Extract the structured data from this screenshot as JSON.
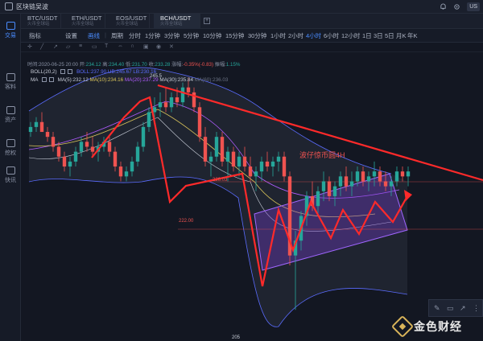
{
  "app": {
    "title": "区块链吴波"
  },
  "topbar": {
    "user_label": "US"
  },
  "sidebar": {
    "items": [
      {
        "label": "交易",
        "active": true
      },
      {
        "label": "客料",
        "active": false
      },
      {
        "label": "资产",
        "active": false
      },
      {
        "label": "挖权",
        "active": false
      },
      {
        "label": "快讯",
        "active": false
      }
    ]
  },
  "tabs": [
    {
      "symbol": "BTC/USDT",
      "sub": "火币全球站"
    },
    {
      "symbol": "ETH/USDT",
      "sub": "火币全球站"
    },
    {
      "symbol": "EOS/USDT",
      "sub": "火币全球站"
    },
    {
      "symbol": "BCH/USDT",
      "sub": "火币全球站",
      "active": true
    }
  ],
  "toolbar": {
    "left": [
      "指标",
      "设置",
      "画线"
    ],
    "period_label": "周期",
    "periods": [
      "分时",
      "1分钟",
      "3分钟",
      "5分钟",
      "10分钟",
      "15分钟",
      "30分钟",
      "1小时",
      "2小时",
      "4小时",
      "6小时",
      "12小时",
      "1日",
      "3日",
      "5日",
      "月K",
      "年K"
    ],
    "active_period": "4小时"
  },
  "ohlc": {
    "time_label": "时间:",
    "time": "2020-06-25 20:00",
    "open_label": "开:",
    "open": "234.12",
    "high_label": "高:",
    "high": "234.40",
    "low_label": "低:",
    "low": "231.70",
    "close_label": "收:",
    "close": "233.28",
    "change_label": "涨幅:",
    "change": "-0.35%(-0.83)",
    "amp_label": "振幅:",
    "amp": "1.15%"
  },
  "indicators": {
    "boll": {
      "name": "BOLL(20,2)",
      "text": "BOLL:237.90 UB:245.67 LB:230.16"
    },
    "ma": {
      "name": "MA",
      "ma5": "MA(5):232.12",
      "ma10": "MA(10):234.16",
      "ma20": "MA(20):237.29",
      "ma30": "MA(30):235.84",
      "ma60": "MA(60):236.03"
    }
  },
  "chart_labels": {
    "high_marker": "245.5",
    "level_1": "226.03",
    "level_2": "222.00",
    "low_marker": "205",
    "annotation": "波仔惊币圆4H"
  },
  "colors": {
    "up": "#26a69a",
    "down": "#ef5350",
    "accent": "#4a8cff",
    "channel": "#7b3fd6",
    "annotation": "#ff2a2a"
  },
  "watermark": {
    "text": "金色财经"
  },
  "candles": [
    [
      241,
      243,
      240,
      242
    ],
    [
      242,
      244,
      241,
      243
    ],
    [
      243,
      245,
      242,
      241
    ],
    [
      241,
      242,
      239,
      240
    ],
    [
      240,
      241,
      237,
      238
    ],
    [
      238,
      239,
      235,
      236
    ],
    [
      236,
      237,
      233,
      234
    ],
    [
      234,
      236,
      232,
      235
    ],
    [
      235,
      238,
      234,
      237
    ],
    [
      237,
      240,
      236,
      239
    ],
    [
      239,
      241,
      237,
      238
    ],
    [
      238,
      240,
      236,
      237
    ],
    [
      237,
      239,
      235,
      238
    ],
    [
      238,
      240,
      237,
      239
    ],
    [
      239,
      240,
      236,
      237
    ],
    [
      237,
      238,
      233,
      234
    ],
    [
      234,
      235,
      231,
      232
    ],
    [
      232,
      234,
      231,
      233
    ],
    [
      233,
      236,
      232,
      235
    ],
    [
      235,
      239,
      234,
      238
    ],
    [
      238,
      243,
      237,
      242
    ],
    [
      242,
      246,
      241,
      245
    ],
    [
      245,
      248,
      243,
      246
    ],
    [
      246,
      249,
      244,
      247
    ],
    [
      247,
      250,
      245,
      246
    ],
    [
      246,
      249,
      245,
      248
    ],
    [
      248,
      250,
      246,
      247
    ],
    [
      247,
      251,
      246,
      250
    ],
    [
      250,
      252,
      248,
      249
    ],
    [
      249,
      250,
      245,
      246
    ],
    [
      246,
      247,
      239,
      240
    ],
    [
      240,
      242,
      234,
      235
    ],
    [
      235,
      237,
      232,
      236
    ],
    [
      236,
      241,
      235,
      240
    ],
    [
      240,
      241,
      234,
      235
    ],
    [
      235,
      238,
      231,
      237
    ],
    [
      237,
      238,
      233,
      234
    ],
    [
      234,
      237,
      232,
      236
    ],
    [
      236,
      238,
      233,
      234
    ],
    [
      234,
      236,
      231,
      232
    ],
    [
      232,
      234,
      229,
      233
    ],
    [
      233,
      236,
      231,
      235
    ],
    [
      235,
      237,
      233,
      234
    ],
    [
      234,
      236,
      232,
      235
    ],
    [
      235,
      237,
      233,
      236
    ],
    [
      236,
      237,
      231,
      232
    ],
    [
      232,
      233,
      214,
      216
    ],
    [
      216,
      221,
      205,
      219
    ],
    [
      219,
      225,
      217,
      224
    ],
    [
      224,
      229,
      222,
      228
    ],
    [
      228,
      231,
      225,
      226
    ],
    [
      226,
      230,
      224,
      229
    ],
    [
      229,
      233,
      227,
      231
    ],
    [
      231,
      232,
      227,
      228
    ],
    [
      228,
      231,
      226,
      230
    ],
    [
      230,
      233,
      228,
      232
    ],
    [
      232,
      234,
      229,
      230
    ],
    [
      230,
      233,
      228,
      231
    ],
    [
      231,
      234,
      230,
      233
    ],
    [
      233,
      234,
      230,
      231
    ],
    [
      231,
      233,
      229,
      232
    ],
    [
      232,
      235,
      230,
      233
    ],
    [
      233,
      234,
      230,
      231
    ],
    [
      231,
      233,
      229,
      230
    ],
    [
      230,
      232,
      228,
      231
    ],
    [
      231,
      234,
      230,
      233
    ],
    [
      233,
      234,
      231,
      232
    ],
    [
      232,
      234,
      230,
      233
    ]
  ]
}
